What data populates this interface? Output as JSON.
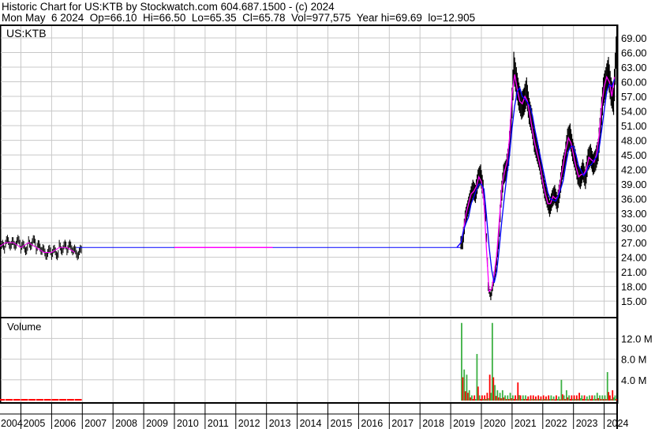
{
  "header": {
    "line1": "Historic Chart for US:KTB by Stockwatch.com 604.687.1500 - (c) 2024",
    "line2": "Mon May  6 2024  Op=66.10  Hi=66.50  Lo=65.35  Cl=65.78  Vol=977,575  Year hi=69.69  lo=12.905"
  },
  "chart_data": {
    "type": "line",
    "symbol": "US:KTB",
    "volume_label": "Volume",
    "price_ticks": [
      "69.00",
      "66.00",
      "63.00",
      "60.00",
      "57.00",
      "54.00",
      "51.00",
      "48.00",
      "45.00",
      "42.00",
      "39.00",
      "36.00",
      "33.00",
      "30.00",
      "27.00",
      "24.00",
      "21.00",
      "18.00",
      "15.00"
    ],
    "volume_ticks": [
      "12.0 M",
      "8.0 M",
      "4.0 M"
    ],
    "year_labels": [
      "2004",
      "2005",
      "2006",
      "2007",
      "2008",
      "2009",
      "2010",
      "2011",
      "2012",
      "2013",
      "2014",
      "2015",
      "2016",
      "2017",
      "2018",
      "2019",
      "2020",
      "2021",
      "2022",
      "2023",
      "2024"
    ],
    "early_series": {
      "start": 2004.0,
      "step_years": 0.25,
      "close": [
        25,
        26,
        27,
        27,
        26,
        27,
        26,
        25,
        25,
        26,
        26,
        25
      ]
    },
    "flat_level": 26,
    "main_series": {
      "start": "2019-05",
      "step": "month",
      "close": [
        27,
        32,
        34,
        36,
        38,
        37,
        40,
        41,
        38,
        33,
        18,
        16,
        19,
        22,
        27,
        36,
        41,
        42,
        45,
        52,
        63,
        60,
        57,
        55,
        56,
        58,
        54,
        52,
        48,
        46,
        44,
        41,
        38,
        36,
        34,
        36,
        37,
        35,
        38,
        42,
        44,
        48,
        49,
        46,
        44,
        41,
        40,
        42,
        40,
        44,
        45,
        43,
        44,
        46,
        52,
        58,
        60,
        62,
        58,
        56,
        66
      ],
      "volume_m": [
        15,
        6,
        5,
        2,
        1,
        1,
        9,
        1,
        1,
        1,
        1.5,
        5,
        15,
        3,
        2,
        1.5,
        2,
        1,
        1,
        1.5,
        1,
        1,
        3.5,
        1,
        1,
        1,
        0.8,
        1,
        1,
        0.8,
        1,
        0.8,
        1,
        0.8,
        1,
        1,
        0.8,
        1,
        0.8,
        4,
        1,
        2,
        1,
        1,
        1,
        1,
        1.5,
        1,
        1,
        0.8,
        1,
        1,
        1,
        1.5,
        1,
        1,
        1,
        5.5,
        1,
        2,
        1
      ]
    },
    "colors": {
      "price_bars": "#000000",
      "ma_short": "#ff00ff",
      "ma_long": "#0000ff",
      "volume_up": "#3cb043",
      "volume_down": "#ff0000",
      "grid": "#c8c8c8"
    },
    "grid": true
  }
}
